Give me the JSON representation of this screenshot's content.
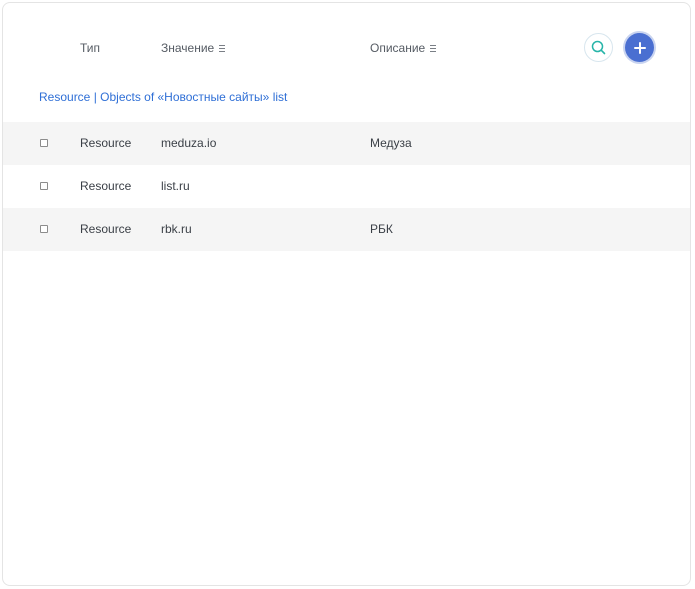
{
  "columns": {
    "type": "Тип",
    "value": "Значение",
    "description": "Описание"
  },
  "icons": {
    "search": "search-icon",
    "add": "plus-icon",
    "sort": "sort-icon"
  },
  "colors": {
    "accent": "#4a6fd1",
    "link": "#2f6fd6",
    "search_icon": "#26b4a8"
  },
  "breadcrumb": "Resource | Objects of «Новостные сайты» list",
  "rows": [
    {
      "type": "Resource",
      "value": "meduza.io",
      "description": "Медуза",
      "checked": false
    },
    {
      "type": "Resource",
      "value": "list.ru",
      "description": "",
      "checked": false
    },
    {
      "type": "Resource",
      "value": "rbk.ru",
      "description": "РБК",
      "checked": false
    }
  ]
}
